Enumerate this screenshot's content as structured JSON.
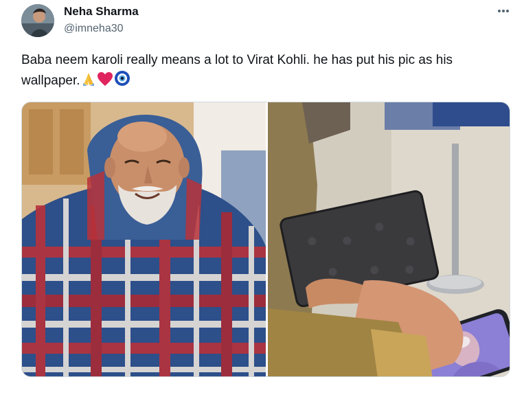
{
  "tweet": {
    "author_name": "Neha Sharma",
    "author_handle": "@imneha30",
    "text": "Baba neem karoli really means a lot to Virat Kohli. he has put his pic as his wallpaper.",
    "emojis": [
      "folded-hands-icon",
      "red-heart-icon",
      "nazar-amulet-icon"
    ],
    "media_count": 2
  },
  "colors": {
    "text": "#0f1419",
    "secondary": "#536471",
    "heart": "#e0245e",
    "nazar": "#1d4fb8"
  }
}
